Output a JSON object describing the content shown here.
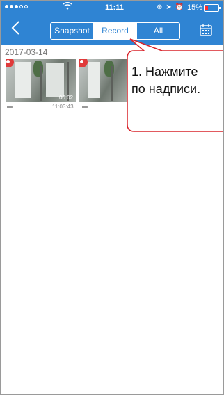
{
  "status_bar": {
    "time": "11:11",
    "battery_percent": "15%",
    "signal_dots": 5,
    "signal_filled": 3
  },
  "navbar": {
    "tabs": [
      {
        "label": "Snapshot",
        "selected": false
      },
      {
        "label": "Record",
        "selected": true
      },
      {
        "label": "All",
        "selected": false
      }
    ],
    "accent_color": "#2f84d3"
  },
  "date_header": "2017-03-14",
  "recordings": [
    {
      "duration": "00:02",
      "time": "11:03:43"
    },
    {
      "duration": "",
      "time": ""
    }
  ],
  "annotation": {
    "line1": "1. Нажмите",
    "line2": "по надписи.",
    "border_color": "#d9232a"
  }
}
